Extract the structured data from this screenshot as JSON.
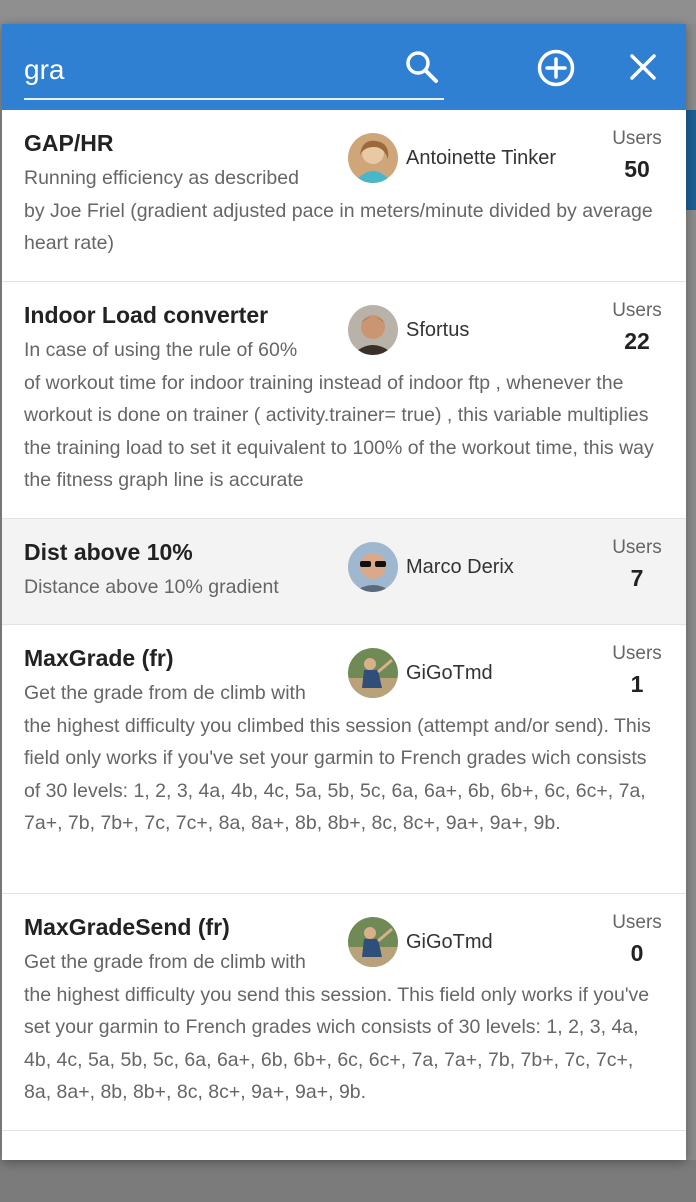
{
  "search": {
    "value": "gra",
    "icons": {
      "search": "search-icon",
      "add": "add-circle-icon",
      "close": "close-icon"
    }
  },
  "colors": {
    "header": "#2f7fd3",
    "selected_row": "#f3f3f3",
    "overlay": "#8c8c8c"
  },
  "results": [
    {
      "name": "GAP/HR",
      "author": "Antoinette Tinker",
      "users_label": "Users",
      "users": "50",
      "desc_first": "Running efficiency as described",
      "desc_rest": "by Joe Friel (gradient adjusted pace in meters/minute divided by average heart rate)"
    },
    {
      "name": "Indoor Load converter",
      "author": "Sfortus",
      "users_label": "Users",
      "users": "22",
      "desc_first": "In case of using the rule of 60%",
      "desc_rest": "of workout time for indoor training instead of indoor ftp , whenever the workout is done on trainer ( activity.trainer= true) , this variable multiplies the training load to set it equivalent to 100% of the workout time, this way the fitness graph line is accurate"
    },
    {
      "name": "Dist above 10%",
      "author": "Marco Derix",
      "users_label": "Users",
      "users": "7",
      "desc_first": "Distance above 10% gradient",
      "desc_rest": ""
    },
    {
      "name": "MaxGrade (fr)",
      "author": "GiGoTmd",
      "users_label": "Users",
      "users": "1",
      "desc_first": "Get the grade from de climb with",
      "desc_rest": "the highest difficulty you climbed this session (attempt and/or send). This field only works if you've set your garmin to French grades wich consists of 30 levels: 1, 2, 3, 4a, 4b, 4c, 5a, 5b, 5c, 6a, 6a+, 6b, 6b+, 6c, 6c+, 7a, 7a+, 7b, 7b+, 7c, 7c+, 8a, 8a+, 8b, 8b+, 8c, 8c+, 9a+, 9a+, 9b."
    },
    {
      "name": "MaxGradeSend (fr)",
      "author": "GiGoTmd",
      "users_label": "Users",
      "users": "0",
      "desc_first": "Get the grade from de climb with",
      "desc_rest": "the highest difficulty you send this session. This field only works if you've set your garmin to French grades wich consists of 30 levels: 1, 2, 3, 4a, 4b, 4c, 5a, 5b, 5c, 6a, 6a+, 6b, 6b+, 6c, 6c+, 7a, 7a+, 7b, 7b+, 7c, 7c+, 8a, 8a+, 8b, 8b+, 8c, 8c+, 9a+, 9a+, 9b."
    }
  ]
}
